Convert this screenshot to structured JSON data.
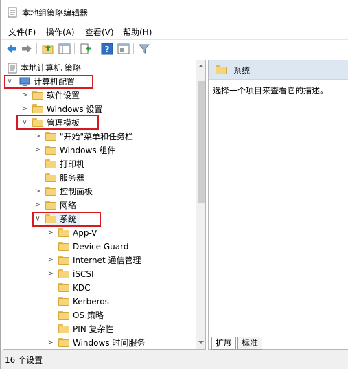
{
  "window": {
    "title": "本地组策略编辑器"
  },
  "menu": [
    "文件(F)",
    "操作(A)",
    "查看(V)",
    "帮助(H)"
  ],
  "toolbar_icons": [
    "back-arrow-icon",
    "forward-arrow-icon",
    "up-folder-icon",
    "show-hide-tree-icon",
    "export-list-icon",
    "help-icon",
    "properties-icon",
    "filter-icon"
  ],
  "tree": {
    "root": "本地计算机 策略",
    "computer_config": "计算机配置",
    "software_settings": "软件设置",
    "windows_settings": "Windows 设置",
    "admin_templates": "管理模板",
    "start_menu": "\"开始\"菜单和任务栏",
    "windows_components": "Windows 组件",
    "printers": "打印机",
    "server": "服务器",
    "control_panel": "控制面板",
    "network": "网络",
    "system": "系统",
    "children": [
      "App-V",
      "Device Guard",
      "Internet 通信管理",
      "iSCSI",
      "KDC",
      "Kerberos",
      "OS 策略",
      "PIN 复杂性",
      "Windows 时间服务"
    ]
  },
  "right": {
    "header": "系统",
    "description": "选择一个项目来查看它的描述。",
    "tabs": [
      "扩展",
      "标准"
    ]
  },
  "status": "16 个设置",
  "colors": {
    "highlight_border": "#d71920",
    "header_bg": "#dde7f1",
    "selection_bg": "#e5f1fb"
  }
}
